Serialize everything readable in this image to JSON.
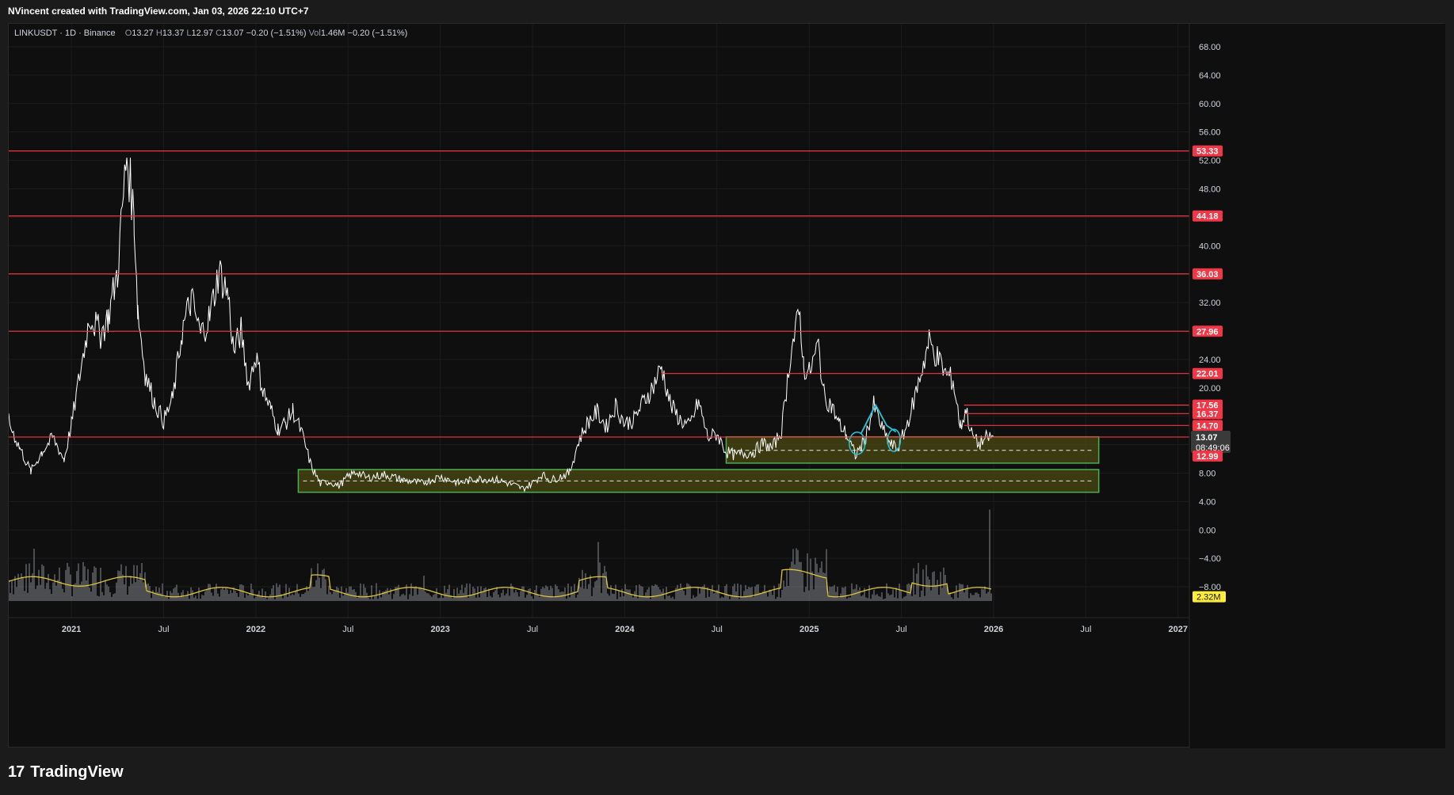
{
  "header": {
    "credit": "NVincent created with TradingView.com, Jan 03, 2026 22:10 UTC+7"
  },
  "legend": {
    "symbol": "LINKUSDT · 1D · Binance",
    "o_label": "O",
    "o": "13.27",
    "h_label": "H",
    "h": "13.37",
    "l_label": "L",
    "l": "12.97",
    "c_label": "C",
    "c": "13.07",
    "change": "−0.20 (−1.51%)",
    "vol_label": "Vol",
    "vol": "1.46M",
    "vol_change": "−0.20 (−1.51%)"
  },
  "footer": {
    "logo": "17",
    "brand": "TradingView"
  },
  "colors": {
    "background": "#0f0f0f",
    "price": "#ffffff",
    "level": "#f23645",
    "zone_fill": "#4b4a12",
    "zone_border": "#4caf50",
    "volume": "#b2b5be",
    "volume_ma": "#e0c63a",
    "annotation": "#26c6da"
  },
  "chart_data": {
    "type": "line",
    "symbol": "LINKUSDT",
    "interval": "1D",
    "exchange": "Binance",
    "ylim": [
      -10,
      70
    ],
    "y_ticks": [
      "68.00",
      "64.00",
      "60.00",
      "56.00",
      "52.00",
      "48.00",
      "44.00",
      "40.00",
      "36.00",
      "32.00",
      "28.00",
      "24.00",
      "20.00",
      "16.00",
      "12.00",
      "8.00",
      "4.00",
      "0.00",
      "−4.00",
      "−8.00"
    ],
    "y_tick_values": [
      68,
      64,
      60,
      56,
      52,
      48,
      44,
      40,
      36,
      32,
      28,
      24,
      20,
      16,
      12,
      8,
      4,
      0,
      -4,
      -8
    ],
    "x_ticks": [
      {
        "label": "2021",
        "t": 2021.0
      },
      {
        "label": "Jul",
        "t": 2021.5
      },
      {
        "label": "2022",
        "t": 2022.0
      },
      {
        "label": "Jul",
        "t": 2022.5
      },
      {
        "label": "2023",
        "t": 2023.0
      },
      {
        "label": "Jul",
        "t": 2023.5
      },
      {
        "label": "2024",
        "t": 2024.0
      },
      {
        "label": "Jul",
        "t": 2024.5
      },
      {
        "label": "2025",
        "t": 2025.0
      },
      {
        "label": "Jul",
        "t": 2025.5
      },
      {
        "label": "2026",
        "t": 2026.0
      },
      {
        "label": "Jul",
        "t": 2026.5
      },
      {
        "label": "2027",
        "t": 2027.0
      }
    ],
    "xlim": [
      2020.66,
      2028.35
    ],
    "price_series": {
      "name": "LINKUSDT",
      "t": [
        2020.66,
        2020.72,
        2020.78,
        2020.84,
        2020.9,
        2020.96,
        2021.0,
        2021.05,
        2021.1,
        2021.16,
        2021.2,
        2021.25,
        2021.3,
        2021.34,
        2021.36,
        2021.4,
        2021.45,
        2021.5,
        2021.55,
        2021.6,
        2021.65,
        2021.7,
        2021.75,
        2021.8,
        2021.85,
        2021.88,
        2021.92,
        2021.96,
        2022.0,
        2022.04,
        2022.08,
        2022.12,
        2022.16,
        2022.2,
        2022.25,
        2022.3,
        2022.35,
        2022.4,
        2022.45,
        2022.5,
        2022.55,
        2022.6,
        2022.7,
        2022.8,
        2022.9,
        2023.0,
        2023.1,
        2023.2,
        2023.3,
        2023.4,
        2023.45,
        2023.5,
        2023.55,
        2023.6,
        2023.7,
        2023.75,
        2023.8,
        2023.85,
        2023.9,
        2023.95,
        2024.0,
        2024.05,
        2024.1,
        2024.15,
        2024.2,
        2024.25,
        2024.3,
        2024.35,
        2024.4,
        2024.45,
        2024.5,
        2024.55,
        2024.6,
        2024.65,
        2024.7,
        2024.75,
        2024.8,
        2024.85,
        2024.9,
        2024.95,
        2024.97,
        2025.0,
        2025.05,
        2025.08,
        2025.12,
        2025.16,
        2025.2,
        2025.25,
        2025.3,
        2025.35,
        2025.4,
        2025.44,
        2025.48,
        2025.52,
        2025.56,
        2025.6,
        2025.65,
        2025.7,
        2025.74,
        2025.78,
        2025.82,
        2025.85,
        2025.88,
        2025.92,
        2025.96,
        2026.0
      ],
      "close": [
        15.2,
        11.5,
        8.2,
        11.0,
        13.0,
        9.9,
        14.8,
        22.5,
        30.2,
        27.5,
        30.0,
        36.4,
        52.8,
        44.0,
        31.0,
        22.0,
        18.0,
        15.3,
        18.5,
        28.0,
        32.5,
        27.5,
        30.0,
        36.5,
        33.0,
        25.0,
        28.0,
        20.5,
        24.5,
        19.5,
        17.0,
        14.2,
        15.0,
        16.8,
        13.5,
        9.0,
        6.5,
        6.8,
        6.2,
        7.5,
        8.2,
        7.3,
        7.8,
        7.0,
        6.6,
        7.5,
        6.6,
        7.2,
        7.1,
        6.3,
        5.8,
        6.6,
        7.8,
        7.0,
        8.0,
        12.5,
        15.2,
        16.6,
        14.5,
        17.5,
        15.0,
        15.5,
        18.0,
        20.0,
        23.0,
        17.5,
        15.5,
        14.5,
        18.0,
        13.0,
        13.5,
        11.0,
        10.5,
        10.8,
        11.0,
        12.2,
        11.5,
        14.0,
        25.0,
        30.5,
        23.0,
        22.0,
        26.0,
        19.0,
        17.5,
        15.0,
        13.5,
        10.5,
        12.5,
        17.5,
        14.0,
        12.0,
        11.5,
        14.0,
        17.5,
        21.5,
        26.5,
        24.0,
        22.0,
        21.0,
        14.5,
        17.0,
        13.5,
        12.0,
        13.0,
        13.07
      ]
    },
    "volume": {
      "name": "Vol",
      "current_label": "2.32M"
    },
    "levels": [
      {
        "value": 53.33,
        "label": "53.33",
        "from": 2020.66
      },
      {
        "value": 44.18,
        "label": "44.18",
        "from": 2020.66
      },
      {
        "value": 36.03,
        "label": "36.03",
        "from": 2020.66
      },
      {
        "value": 27.96,
        "label": "27.96",
        "from": 2020.66
      },
      {
        "value": 22.01,
        "label": "22.01",
        "from": 2024.2
      },
      {
        "value": 17.56,
        "label": "17.56",
        "from": 2025.84
      },
      {
        "value": 16.37,
        "label": "16.37",
        "from": 2025.84
      },
      {
        "value": 14.7,
        "label": "14.70",
        "from": 2025.84
      },
      {
        "value": 13.07,
        "label": "13.07",
        "from": 2020.66
      }
    ],
    "zones": [
      {
        "t1": 2024.55,
        "t2": 2026.57,
        "top": 13.1,
        "bottom": 9.4,
        "mid": 11.2
      },
      {
        "t1": 2022.23,
        "t2": 2026.57,
        "top": 8.5,
        "bottom": 5.3,
        "mid": 6.9
      }
    ],
    "price_label": {
      "value": "13.07",
      "countdown": "08:49:06"
    },
    "low_label": {
      "value": "12.99"
    }
  }
}
